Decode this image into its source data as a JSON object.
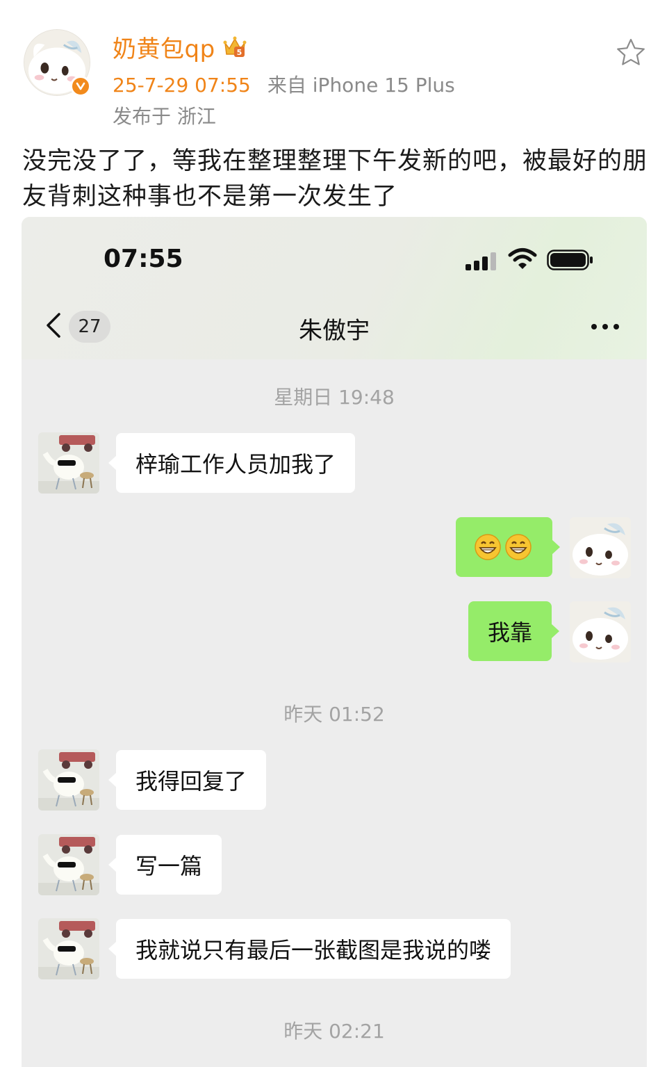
{
  "post": {
    "username": "奶黄包qp",
    "vip_badge": "5",
    "time": "25-7-29 07:55",
    "source": "来自 iPhone 15 Plus",
    "location": "发布于 浙江",
    "text": "没完没了了，等我在整理整理下午发新的吧，被最好的朋友背刺这种事也不是第一次发生了",
    "icons": [
      "verified-icon",
      "vip-crown-icon",
      "star-icon"
    ]
  },
  "screenshot": {
    "status_bar": {
      "time": "07:55"
    },
    "nav": {
      "unread_count": "27",
      "title": "朱傲宇"
    },
    "timestamps": [
      "星期日 19:48",
      "昨天 01:52",
      "昨天 02:21"
    ],
    "messages": [
      {
        "side": "left",
        "text": "梓瑜工作人员加我了"
      },
      {
        "side": "right",
        "emoji": [
          "grinning-face",
          "grinning-face"
        ]
      },
      {
        "side": "right",
        "text": "我靠"
      },
      {
        "side": "left",
        "text": "我得回复了"
      },
      {
        "side": "left",
        "text": "写一篇"
      },
      {
        "side": "left",
        "text": "我就说只有最后一张截图是我说的喽"
      }
    ]
  },
  "colors": {
    "username_orange": "#f08418",
    "bubble_green": "#95ec69",
    "bubble_white": "#ffffff",
    "chat_bg": "#ededed",
    "meta_gray": "#8a8a8a"
  }
}
